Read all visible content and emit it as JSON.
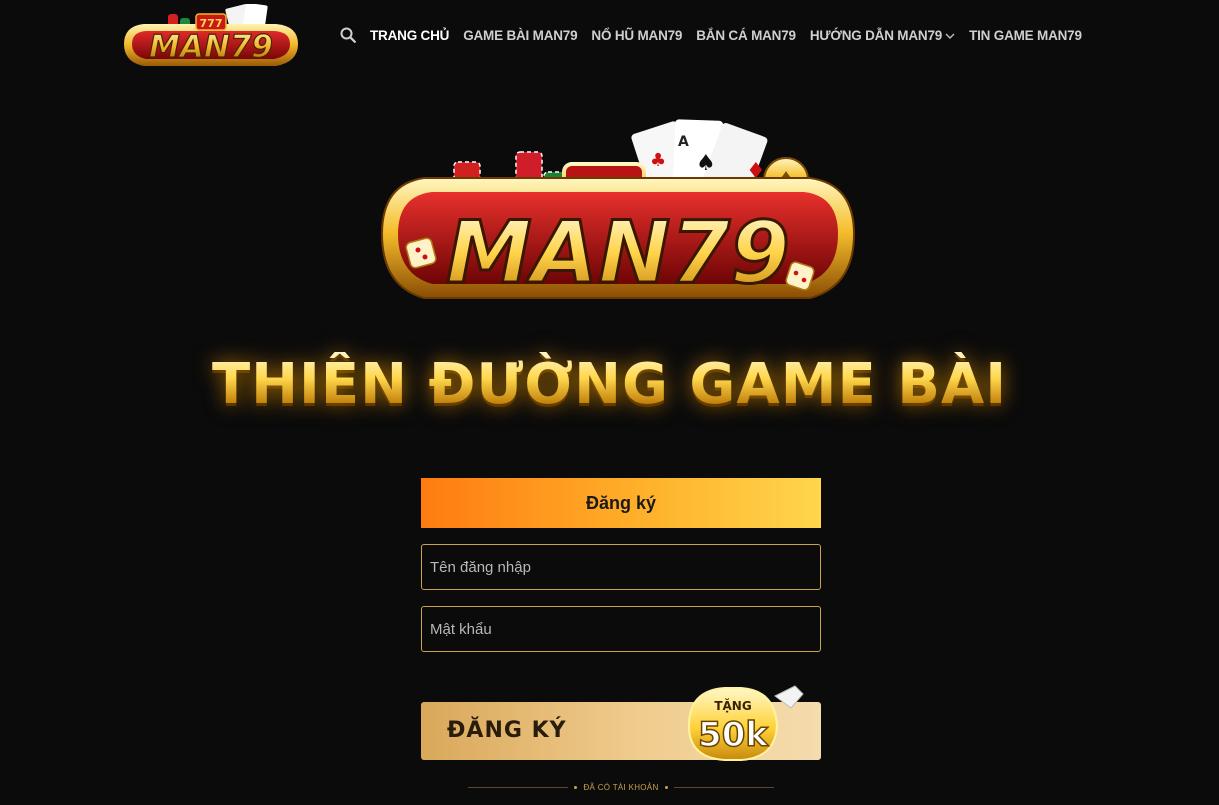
{
  "brand": {
    "logo_text": "MAN79",
    "slot_text": "777"
  },
  "nav": {
    "items": [
      {
        "label": "TRANG CHỦ"
      },
      {
        "label": "GAME BÀI MAN79"
      },
      {
        "label": "NỔ HŨ MAN79"
      },
      {
        "label": "BẮN CÁ MAN79"
      },
      {
        "label": "HƯỚNG DẪN MAN79"
      },
      {
        "label": "TIN GAME MAN79"
      }
    ]
  },
  "hero": {
    "slogan": "THIÊN ĐƯỜNG GAME BÀI"
  },
  "form": {
    "tab_label": "Đăng ký",
    "username_placeholder": "Tên đăng nhập",
    "password_placeholder": "Mật khẩu",
    "submit_label": "ĐĂNG KÝ",
    "badge_top": "TẶNG",
    "badge_value": "50k",
    "divider_text": "ĐÃ CÓ TÀI KHOẢN"
  },
  "colors": {
    "background": "#0b0b0b",
    "gold": "#f7c94a",
    "accent_orange": "#ff7b10",
    "logo_red": "#b81414"
  }
}
